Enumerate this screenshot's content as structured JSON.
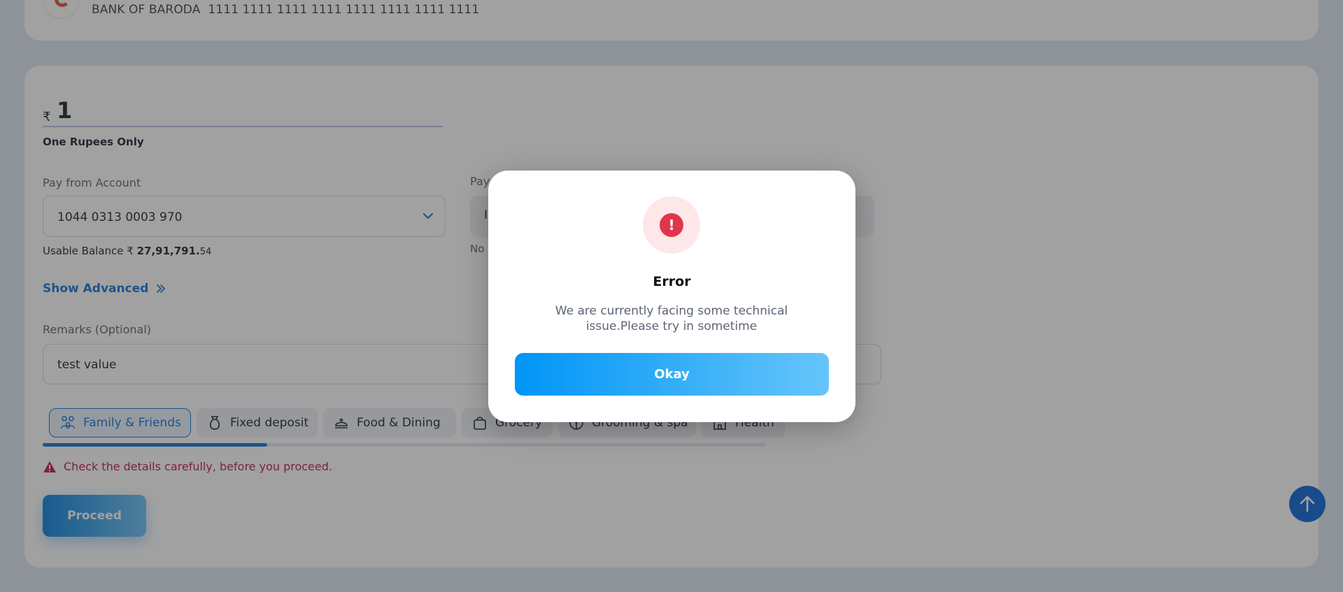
{
  "beneficiary": {
    "bank_name": "BANK OF BARODA",
    "account_number": "1111 1111 1111 1111 1111 1111 1111 1111"
  },
  "amount": {
    "currency_symbol": "₹",
    "value": "1",
    "in_words": "One Rupees Only"
  },
  "pay_from": {
    "label": "Pay from Account",
    "account": "1044 0313 0003 970",
    "balance_label": "Usable Balance ₹",
    "balance_main": "27,91,791.",
    "balance_decimal": "54"
  },
  "pay_to": {
    "label": "Pay",
    "value_partial": "I",
    "note_partial": "No"
  },
  "show_advanced": "Show Advanced",
  "remarks": {
    "label": "Remarks (Optional)",
    "value": "test value"
  },
  "categories": [
    {
      "label": "Family & Friends",
      "icon": "family-icon",
      "active": true
    },
    {
      "label": "Fixed deposit",
      "icon": "money-bag-icon",
      "active": false
    },
    {
      "label": "Food & Dining",
      "icon": "dining-icon",
      "active": false
    },
    {
      "label": "Grocery",
      "icon": "grocery-bag-icon",
      "active": false
    },
    {
      "label": "Grooming & spa",
      "icon": "grooming-icon",
      "active": false
    },
    {
      "label": "Health",
      "icon": "hospital-icon",
      "active": false
    }
  ],
  "category_scroll_fraction": 0.31,
  "warning": "Check the details carefully, before you proceed.",
  "proceed_label": "Proceed",
  "modal": {
    "icon_text": "!",
    "title": "Error",
    "message": "We are currently facing some technical issue.Please try in sometime",
    "button_label": "Okay"
  },
  "colors": {
    "accent": "#1477d6",
    "error": "#e0354f",
    "warning_text": "#c61a4a"
  }
}
